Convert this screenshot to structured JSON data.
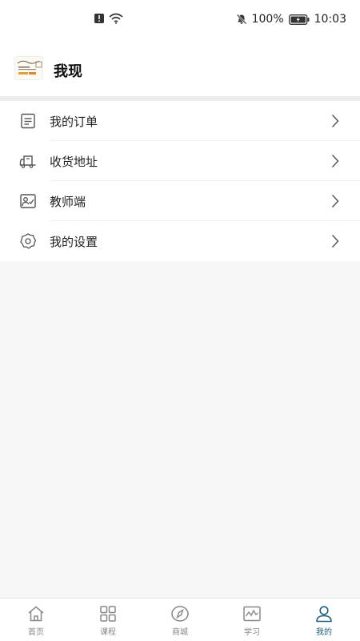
{
  "status_bar": {
    "battery": "100%",
    "time": "10:03"
  },
  "profile": {
    "username": "我现"
  },
  "menu": {
    "items": [
      {
        "icon": "order-icon",
        "label": "我的订单"
      },
      {
        "icon": "truck-icon",
        "label": "收货地址"
      },
      {
        "icon": "teacher-icon",
        "label": "教师端"
      },
      {
        "icon": "settings-icon",
        "label": "我的设置"
      }
    ]
  },
  "tabbar": {
    "items": [
      {
        "icon": "home-icon",
        "label": "首页"
      },
      {
        "icon": "grid-icon",
        "label": "课程"
      },
      {
        "icon": "compass-icon",
        "label": "商城"
      },
      {
        "icon": "chart-icon",
        "label": "学习"
      },
      {
        "icon": "user-icon",
        "label": "我的"
      }
    ],
    "active": "我的",
    "active_color": "#1e6078",
    "inactive_color": "#888888"
  }
}
